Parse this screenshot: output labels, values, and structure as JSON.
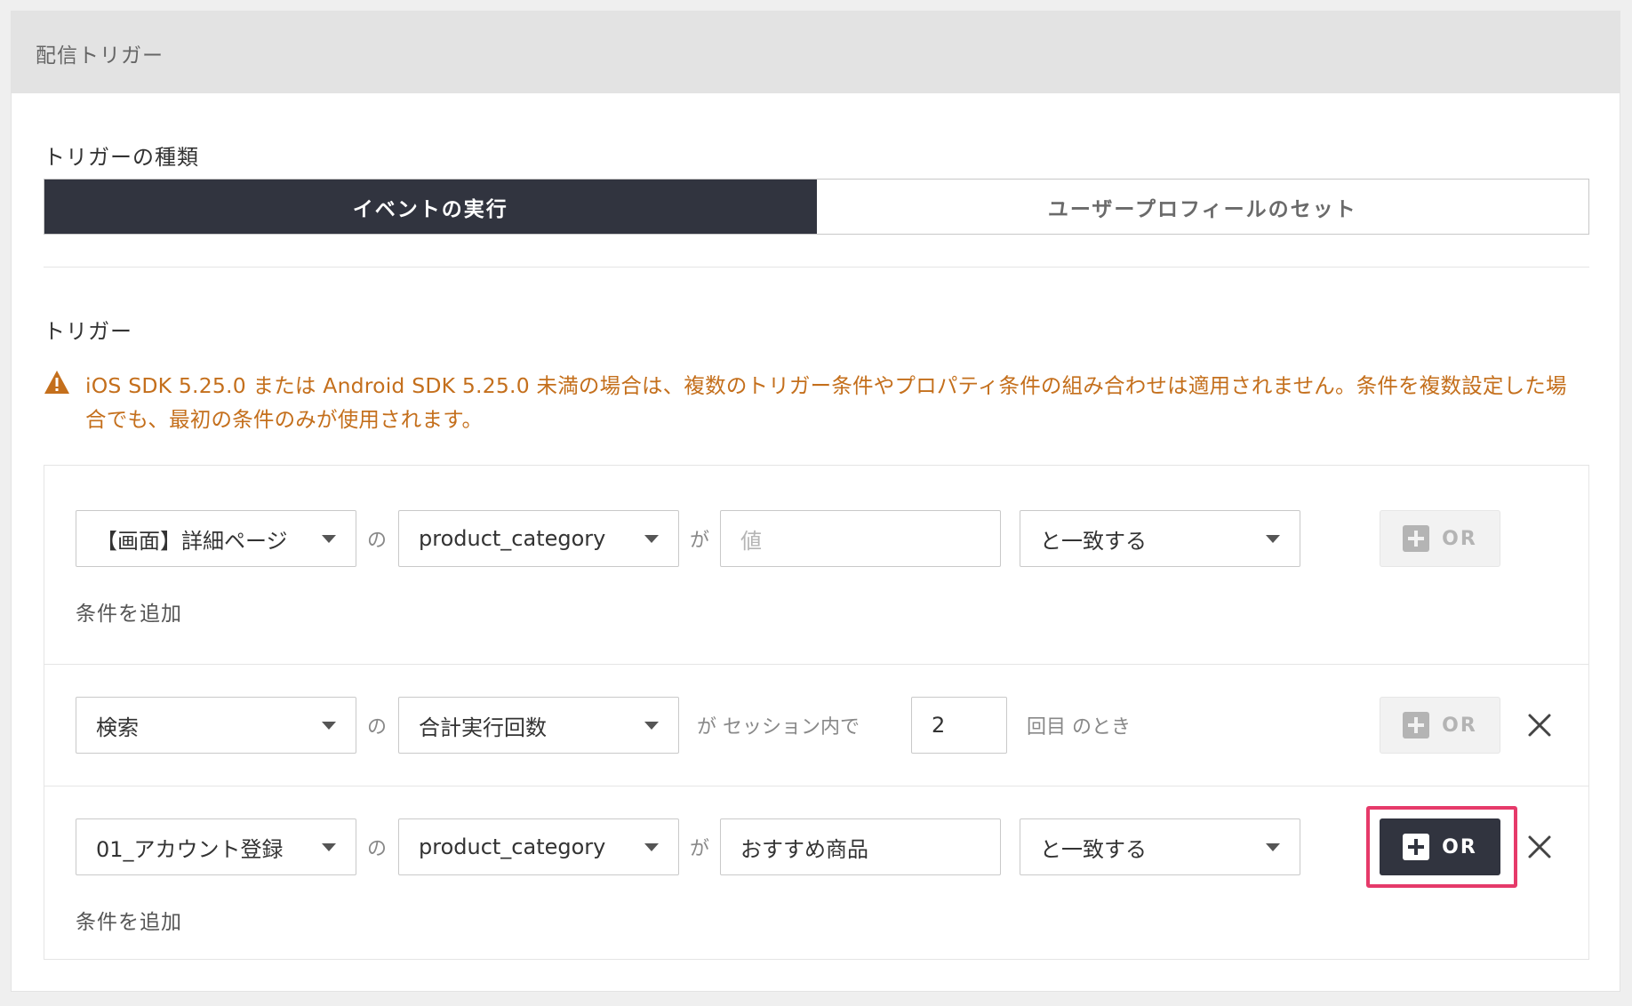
{
  "panel": {
    "title": "配信トリガー"
  },
  "trigger_type": {
    "label": "トリガーの種類",
    "options": [
      "イベントの実行",
      "ユーザープロフィールのセット"
    ],
    "selected": "イベントの実行"
  },
  "trigger_section": {
    "label": "トリガー",
    "warning": "iOS SDK 5.25.0 または Android SDK 5.25.0 未満の場合は、複数のトリガー条件やプロパティ条件の組み合わせは適用されません。条件を複数設定した場合でも、最初の条件のみが使用されます。"
  },
  "rows": [
    {
      "event": "【画面】詳細ページ",
      "of": "の",
      "property": "product_category",
      "ga": "が",
      "value_placeholder": "値",
      "operator": "と一致する",
      "or_label": "OR",
      "add_condition": "条件を追加"
    },
    {
      "event": "検索",
      "of": "の",
      "property": "合計実行回数",
      "session_text": "が セッション内で",
      "count": "2",
      "suffix": "回目 のとき",
      "or_label": "OR"
    },
    {
      "event": "01_アカウント登録",
      "of": "の",
      "property": "product_category",
      "ga": "が",
      "value": "おすすめ商品",
      "operator": "と一致する",
      "or_label": "OR",
      "add_condition": "条件を追加"
    }
  ],
  "icons": {
    "warning": "warning-triangle-icon",
    "plus": "plus-square-icon",
    "close": "close-icon",
    "caret": "caret-down-icon"
  },
  "colors": {
    "dark": "#31343f",
    "warning": "#c46f1c",
    "highlight": "#e63a6a"
  }
}
